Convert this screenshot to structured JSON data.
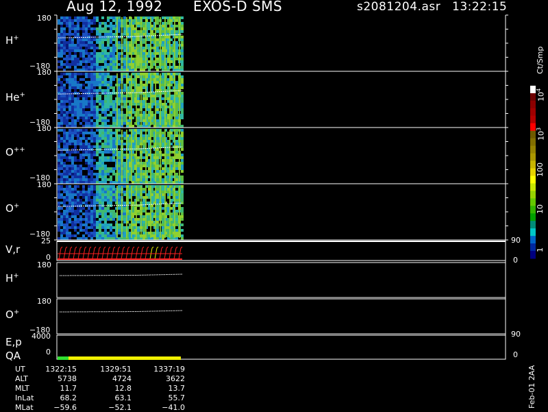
{
  "header": {
    "date": "Aug 12, 1992",
    "instrument": "EXOS-D SMS",
    "file": "s2081204.asr",
    "time": "13:22:15"
  },
  "panels": [
    {
      "label": "H",
      "charge": "+",
      "ymax": "180",
      "ymin": "−180"
    },
    {
      "label": "He",
      "charge": "+",
      "ymax": "180",
      "ymin": "−180"
    },
    {
      "label": "O",
      "charge": "++",
      "ymax": "180",
      "ymin": "−180"
    },
    {
      "label": "O",
      "charge": "+",
      "ymax": "180",
      "ymin": "−180"
    }
  ],
  "vr_panel": {
    "label": "V,r",
    "left_top": "25",
    "left_bottom": "0",
    "right_top": "90",
    "right_bottom": "0"
  },
  "line_panels": [
    {
      "label": "H",
      "charge": "+",
      "ymax": "180"
    },
    {
      "label": "O",
      "charge": "+",
      "ymax": "180",
      "ymin": "−180"
    }
  ],
  "ep_panel": {
    "label1": "E,p",
    "label2": "QA",
    "left_top": "4000",
    "left_bottom": "0",
    "right_top": "90",
    "right_bottom": "0"
  },
  "colorbar": {
    "unit": "Ct/Smp",
    "ticks": [
      {
        "label": "10",
        "sup": "4"
      },
      {
        "label": "10",
        "sup": "3"
      },
      {
        "label": "100",
        "sup": ""
      },
      {
        "label": "10",
        "sup": ""
      },
      {
        "label": "1",
        "sup": ""
      }
    ],
    "colors": [
      "#ffffff",
      "#6e0000",
      "#8c0000",
      "#a00000",
      "#b40000",
      "#ff0000",
      "#6e5a00",
      "#826e00",
      "#968200",
      "#aa9600",
      "#c8b400",
      "#e6d200",
      "#ffff00",
      "#c8e600",
      "#96d200",
      "#64c800",
      "#32b400",
      "#00a000",
      "#008c78",
      "#00c8c8",
      "#0064c8",
      "#0028a0",
      "#000080"
    ]
  },
  "ephemeris": {
    "labels": [
      "UT",
      "ALT",
      "MLT",
      "InLat",
      "MLat"
    ],
    "columns": [
      [
        "1322:15",
        "5738",
        "11.7",
        "68.2",
        "−59.6"
      ],
      [
        "1329:51",
        "4724",
        "12.8",
        "63.1",
        "−52.1"
      ],
      [
        "1337:19",
        "3622",
        "13.7",
        "55.7",
        "−41.0"
      ]
    ]
  },
  "footer_code": "Feb-01 2AA"
}
